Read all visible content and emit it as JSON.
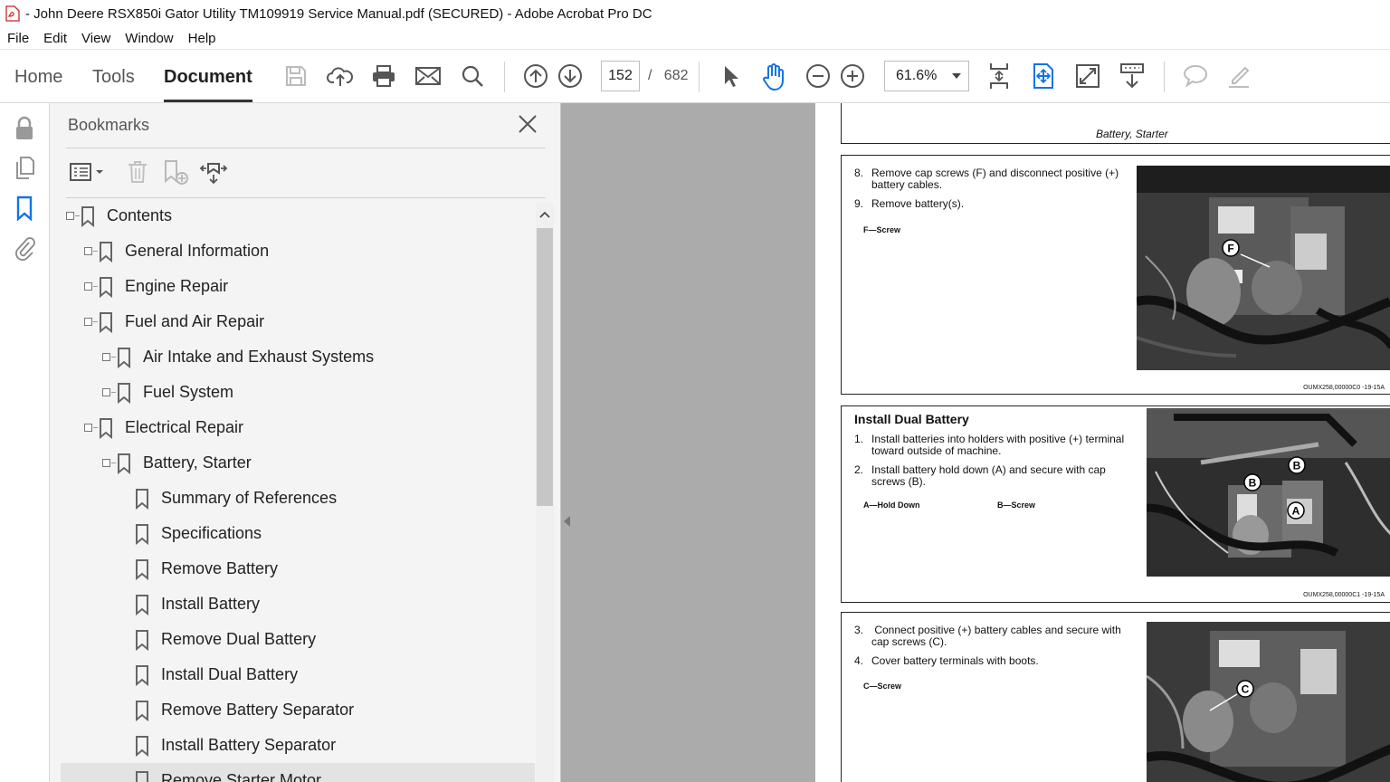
{
  "window": {
    "title": "- John Deere RSX850i Gator Utility TM109919 Service Manual.pdf (SECURED) - Adobe Acrobat Pro DC"
  },
  "menu": [
    "File",
    "Edit",
    "View",
    "Window",
    "Help"
  ],
  "toolbar": {
    "nav": [
      "Home",
      "Tools",
      "Document"
    ],
    "active_nav": "Document",
    "page_current": "152",
    "page_sep": "/",
    "page_total": "682",
    "zoom": "61.6%"
  },
  "bookmarks": {
    "title": "Bookmarks",
    "items": [
      {
        "label": "Contents",
        "level": 0,
        "expander": true
      },
      {
        "label": "General Information",
        "level": 1,
        "expander": true
      },
      {
        "label": "Engine Repair",
        "level": 1,
        "expander": true
      },
      {
        "label": "Fuel and Air Repair",
        "level": 1,
        "expander": true
      },
      {
        "label": "Air Intake and Exhaust Systems",
        "level": 2,
        "expander": true
      },
      {
        "label": "Fuel System",
        "level": 2,
        "expander": true
      },
      {
        "label": "Electrical Repair",
        "level": 1,
        "expander": true
      },
      {
        "label": "Battery, Starter",
        "level": 2,
        "expander": true
      },
      {
        "label": "Summary of References",
        "level": 3,
        "expander": false
      },
      {
        "label": "Specifications",
        "level": 3,
        "expander": false
      },
      {
        "label": "Remove Battery",
        "level": 3,
        "expander": false
      },
      {
        "label": "Install Battery",
        "level": 3,
        "expander": false
      },
      {
        "label": "Remove Dual Battery",
        "level": 3,
        "expander": false
      },
      {
        "label": "Install Dual Battery",
        "level": 3,
        "expander": false
      },
      {
        "label": "Remove Battery Separator",
        "level": 3,
        "expander": false
      },
      {
        "label": "Install Battery Separator",
        "level": 3,
        "expander": false
      },
      {
        "label": "Remove Starter Motor",
        "level": 3,
        "expander": false
      }
    ]
  },
  "document": {
    "section_header": "Battery, Starter",
    "block1": {
      "step8_num": "8.",
      "step8": "Remove cap screws (F) and disconnect positive (+) battery cables.",
      "step9_num": "9.",
      "step9": "Remove battery(s).",
      "legend": "F—Screw",
      "photo_label": "F",
      "code": "OUMX258,00000C0 -19-15A"
    },
    "block2": {
      "heading": "Install Dual Battery",
      "step1_num": "1.",
      "step1": "Install batteries into holders with positive (+) terminal toward outside of machine.",
      "step2_num": "2.",
      "step2": "Install battery hold down (A) and secure with cap screws (B).",
      "legend_a": "A—Hold Down",
      "legend_b": "B—Screw",
      "photo_labels": [
        "B",
        "B",
        "A"
      ],
      "code": "OUMX258,00000C1 -19-15A"
    },
    "block3": {
      "step3_num": "3.",
      "step3": " Connect positive (+) battery cables and secure with cap screws (C).",
      "step4_num": "4.",
      "step4": "Cover battery terminals with boots.",
      "legend": "C—Screw",
      "photo_label": "C"
    }
  }
}
